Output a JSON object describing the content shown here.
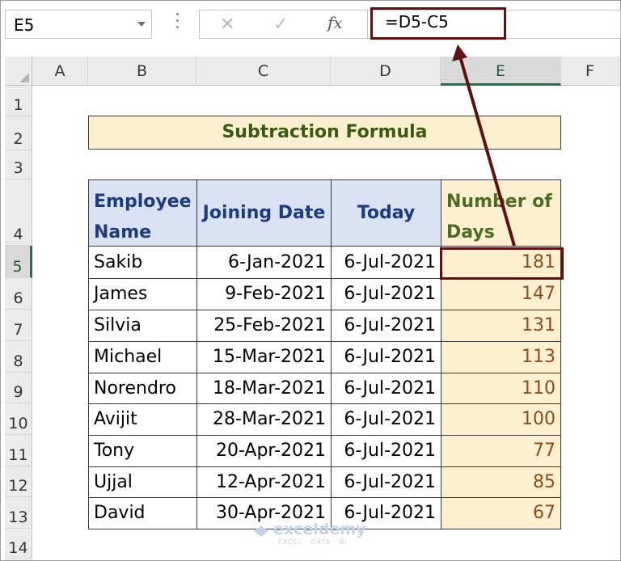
{
  "name_box": {
    "value": "E5"
  },
  "formula_bar": {
    "cancel_icon": "x-icon",
    "enter_icon": "check-icon",
    "fx_label": "fx",
    "formula": "=D5-C5"
  },
  "columns": [
    "A",
    "B",
    "C",
    "D",
    "E",
    "F"
  ],
  "rows": [
    "1",
    "2",
    "3",
    "4",
    "5",
    "6",
    "7",
    "8",
    "9",
    "10",
    "11",
    "12",
    "13",
    "14"
  ],
  "selected_cell": "E5",
  "title": "Subtraction Formula",
  "table": {
    "headers": [
      "Employee Name",
      "Joining Date",
      "Today",
      "Number of Days"
    ],
    "rows": [
      [
        "Sakib",
        "6-Jan-2021",
        "6-Jul-2021",
        "181"
      ],
      [
        "James",
        "9-Feb-2021",
        "6-Jul-2021",
        "147"
      ],
      [
        "Silvia",
        "25-Feb-2021",
        "6-Jul-2021",
        "131"
      ],
      [
        "Michael",
        "15-Mar-2021",
        "6-Jul-2021",
        "113"
      ],
      [
        "Norendro",
        "18-Mar-2021",
        "6-Jul-2021",
        "110"
      ],
      [
        "Avijit",
        "28-Mar-2021",
        "6-Jul-2021",
        "100"
      ],
      [
        "Tony",
        "20-Apr-2021",
        "6-Jul-2021",
        "77"
      ],
      [
        "Ujjal",
        "12-Apr-2021",
        "6-Jul-2021",
        "85"
      ],
      [
        "David",
        "30-Apr-2021",
        "6-Jul-2021",
        "67"
      ]
    ]
  },
  "colors": {
    "highlight": "#5a1212",
    "title_fill": "#fdefcf",
    "header_fill": "#d9e1f2",
    "header_text": "#1f3c78",
    "result_text": "#8a4b1f"
  },
  "watermark": {
    "brand": "exceldemy",
    "tagline": "EXCEL · DATA · BI"
  }
}
